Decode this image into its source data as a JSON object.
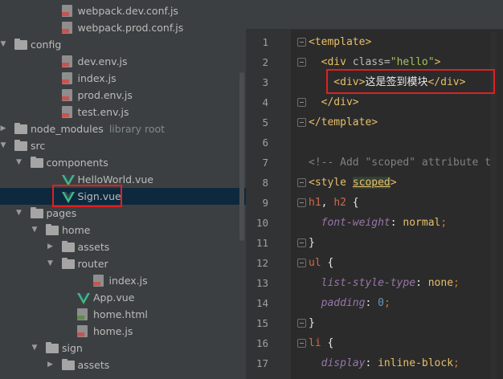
{
  "tree": {
    "rows": [
      {
        "label": "webpack.dev.conf.js",
        "type": "js",
        "indent": 3
      },
      {
        "label": "webpack.prod.conf.js",
        "type": "js",
        "indent": 3
      },
      {
        "label": "config",
        "type": "folder",
        "indent": 0,
        "arrow": "open"
      },
      {
        "label": "dev.env.js",
        "type": "js",
        "indent": 3
      },
      {
        "label": "index.js",
        "type": "js",
        "indent": 3
      },
      {
        "label": "prod.env.js",
        "type": "js",
        "indent": 3
      },
      {
        "label": "test.env.js",
        "type": "js",
        "indent": 3
      },
      {
        "label": "node_modules",
        "type": "folder",
        "indent": 0,
        "arrow": "closed",
        "sub": "library root"
      },
      {
        "label": "src",
        "type": "folder",
        "indent": 0,
        "arrow": "open"
      },
      {
        "label": "components",
        "type": "folder",
        "indent": 1,
        "arrow": "open"
      },
      {
        "label": "HelloWorld.vue",
        "type": "vue",
        "indent": 3
      },
      {
        "label": "Sign.vue",
        "type": "vue",
        "indent": 3,
        "selected": true
      },
      {
        "label": "pages",
        "type": "folder",
        "indent": 1,
        "arrow": "open"
      },
      {
        "label": "home",
        "type": "folder",
        "indent": 2,
        "arrow": "open"
      },
      {
        "label": "assets",
        "type": "folder",
        "indent": 3,
        "arrow": "closed"
      },
      {
        "label": "router",
        "type": "folder",
        "indent": 3,
        "arrow": "open"
      },
      {
        "label": "index.js",
        "type": "js",
        "indent": 5
      },
      {
        "label": "App.vue",
        "type": "vue",
        "indent": 4
      },
      {
        "label": "home.html",
        "type": "html",
        "indent": 4
      },
      {
        "label": "home.js",
        "type": "js",
        "indent": 4
      },
      {
        "label": "sign",
        "type": "folder",
        "indent": 2,
        "arrow": "open"
      },
      {
        "label": "assets",
        "type": "folder",
        "indent": 3,
        "arrow": "closed"
      }
    ]
  },
  "editor": {
    "line_numbers": [
      "1",
      "2",
      "3",
      "4",
      "5",
      "6",
      "7",
      "8",
      "9",
      "10",
      "11",
      "12",
      "13",
      "14",
      "15",
      "16",
      "17"
    ],
    "lines": [
      [
        {
          "c": "t",
          "s": "<template>"
        }
      ],
      [
        {
          "c": "t",
          "s": "  <div "
        },
        {
          "c": "attr",
          "s": "class="
        },
        {
          "c": "str",
          "s": "\"hello\""
        },
        {
          "c": "t",
          "s": ">"
        }
      ],
      [
        {
          "c": "t",
          "s": "    <div>"
        },
        {
          "c": "wh",
          "s": "这是签到模块"
        },
        {
          "c": "t",
          "s": "</div>"
        }
      ],
      [
        {
          "c": "t",
          "s": "  </div>"
        }
      ],
      [
        {
          "c": "t",
          "s": "</template>"
        }
      ],
      [
        {
          "c": "wh",
          "s": ""
        }
      ],
      [
        {
          "c": "cmt",
          "s": "<!-- Add \"scoped\" attribute to"
        }
      ],
      [
        {
          "c": "t",
          "s": "<style "
        },
        {
          "c": "scoped",
          "s": "scoped"
        },
        {
          "c": "t",
          "s": ">"
        }
      ],
      [
        {
          "c": "sel",
          "s": "h1"
        },
        {
          "c": "wh",
          "s": ", "
        },
        {
          "c": "sel",
          "s": "h2"
        },
        {
          "c": "wh",
          "s": " {"
        }
      ],
      [
        {
          "c": "prop",
          "s": "  font-weight"
        },
        {
          "c": "wh",
          "s": ": "
        },
        {
          "c": "propn",
          "s": "normal"
        },
        {
          "c": "kw",
          "s": ";"
        }
      ],
      [
        {
          "c": "wh",
          "s": "}"
        }
      ],
      [
        {
          "c": "sel",
          "s": "ul"
        },
        {
          "c": "wh",
          "s": " {"
        }
      ],
      [
        {
          "c": "prop",
          "s": "  list-style-type"
        },
        {
          "c": "wh",
          "s": ": "
        },
        {
          "c": "propn",
          "s": "none"
        },
        {
          "c": "kw",
          "s": ";"
        }
      ],
      [
        {
          "c": "prop",
          "s": "  padding"
        },
        {
          "c": "wh",
          "s": ": "
        },
        {
          "c": "num",
          "s": "0"
        },
        {
          "c": "kw",
          "s": ";"
        }
      ],
      [
        {
          "c": "wh",
          "s": "}"
        }
      ],
      [
        {
          "c": "sel",
          "s": "li"
        },
        {
          "c": "wh",
          "s": " {"
        }
      ],
      [
        {
          "c": "prop",
          "s": "  display"
        },
        {
          "c": "wh",
          "s": ": "
        },
        {
          "c": "propn",
          "s": "inline-block"
        },
        {
          "c": "kw",
          "s": ";"
        }
      ]
    ],
    "fold_markers": [
      1,
      2,
      4,
      5,
      8,
      9,
      11,
      12,
      15,
      16
    ]
  },
  "colors": {
    "highlight": "#e02020",
    "selection": "#0d293e",
    "vue_green": "#41b883"
  }
}
